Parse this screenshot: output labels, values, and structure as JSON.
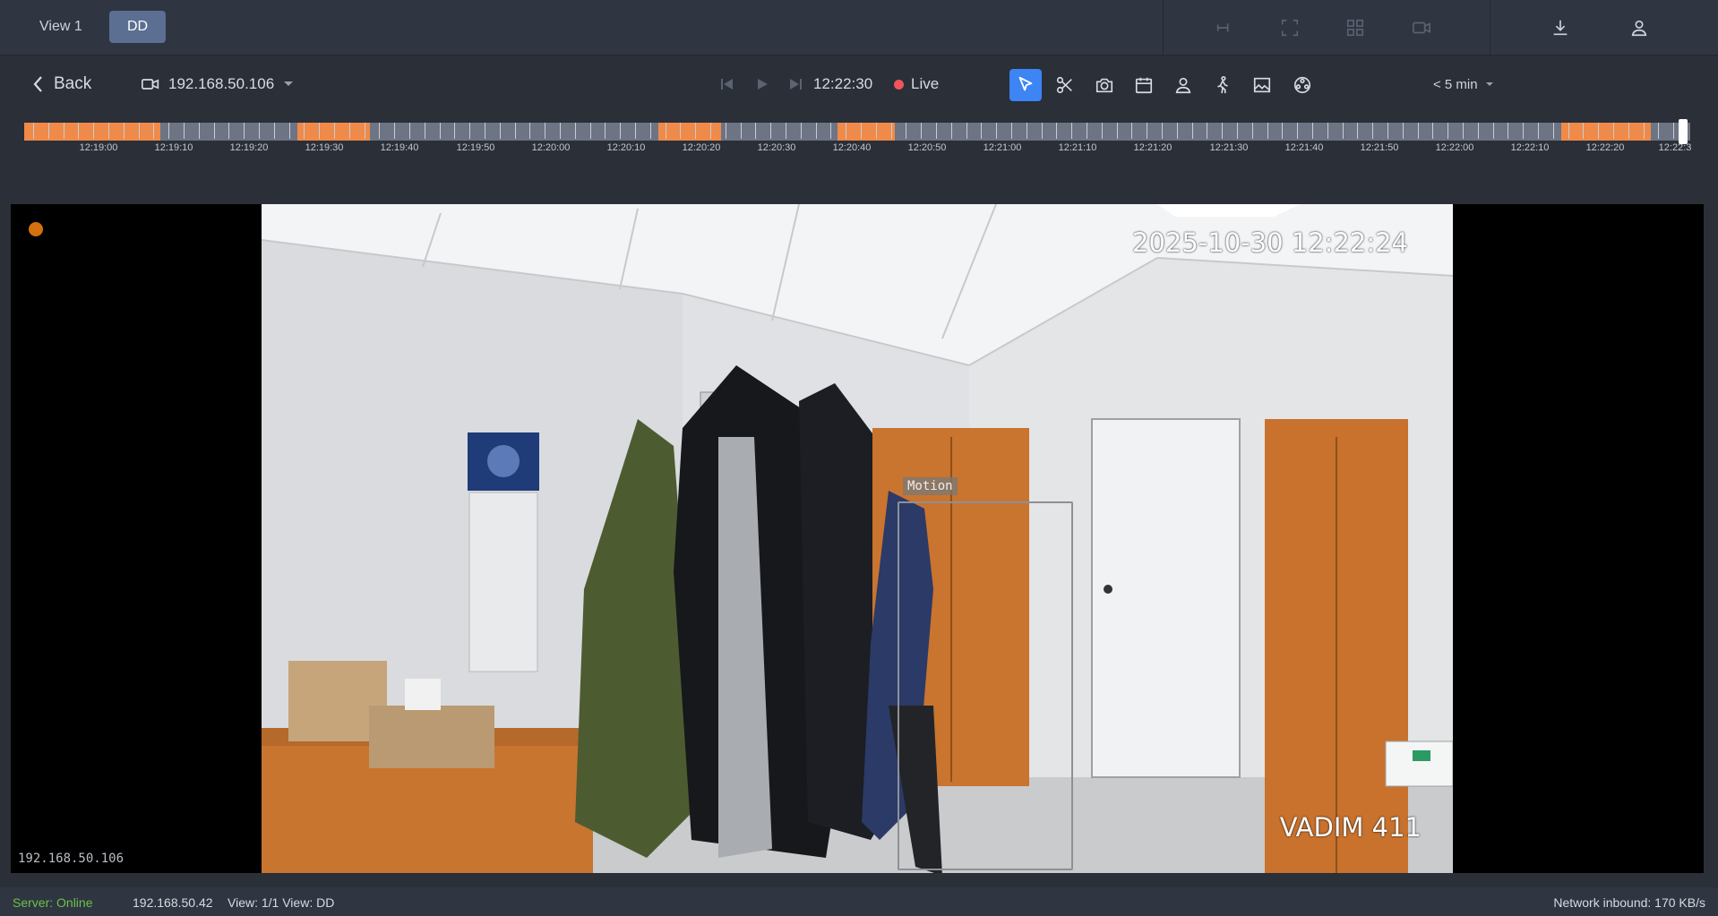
{
  "tabs": [
    {
      "label": "View 1",
      "active": false
    },
    {
      "label": "DD",
      "active": true
    }
  ],
  "top_icons": [
    "pin-icon",
    "fullscreen-icon",
    "grid-icon",
    "camera-icon",
    "download-icon",
    "user-icon"
  ],
  "toolbar": {
    "back_label": "Back",
    "camera_name": "192.168.50.106",
    "time": "12:22:30",
    "live_label": "Live",
    "range_label": "< 5 min",
    "tools": [
      "pointer-icon",
      "scissors-icon",
      "snapshot-icon",
      "calendar-icon",
      "person-icon",
      "walking-person-icon",
      "image-icon",
      "analytics-icon"
    ]
  },
  "timeline": {
    "labels": [
      "12:19:00",
      "12:19:10",
      "12:19:20",
      "12:19:30",
      "12:19:40",
      "12:19:50",
      "12:20:00",
      "12:20:10",
      "12:20:20",
      "12:20:30",
      "12:20:40",
      "12:20:50",
      "12:21:00",
      "12:21:10",
      "12:21:20",
      "12:21:30",
      "12:21:40",
      "12:21:50",
      "12:22:00",
      "12:22:10",
      "12:22:20",
      "12:22:3"
    ]
  },
  "video": {
    "timestamp": "2025-10-30 12:22:24",
    "camera_label": "VADIM 411",
    "motion_label": "Motion",
    "camera_ip": "192.168.50.106"
  },
  "status": {
    "server": "Server: Online",
    "ip": "192.168.50.42",
    "view": "View: 1/1  View: DD",
    "network": "Network inbound: 170 KB/s"
  },
  "colors": {
    "accent": "#3d84f5",
    "recording": "#f08a48",
    "live": "#f2545b",
    "online": "#6cc24a"
  }
}
